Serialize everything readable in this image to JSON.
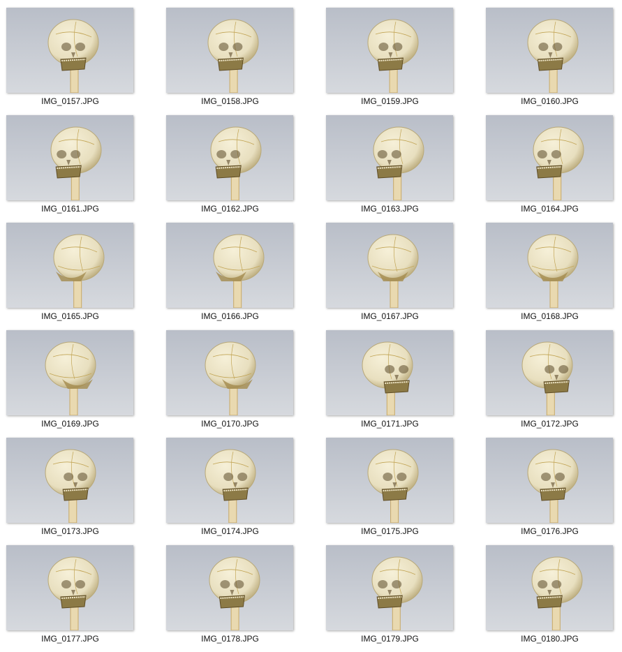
{
  "window": {
    "view": "large-icons",
    "files": [
      {
        "name": "IMG_0157.JPG",
        "icon": "skull-photo-thumbnail",
        "view": "front"
      },
      {
        "name": "IMG_0158.JPG",
        "icon": "skull-photo-thumbnail",
        "view": "front-right"
      },
      {
        "name": "IMG_0159.JPG",
        "icon": "skull-photo-thumbnail",
        "view": "front-right"
      },
      {
        "name": "IMG_0160.JPG",
        "icon": "skull-photo-thumbnail",
        "view": "front-right"
      },
      {
        "name": "IMG_0161.JPG",
        "icon": "skull-photo-thumbnail",
        "view": "left-oblique"
      },
      {
        "name": "IMG_0162.JPG",
        "icon": "skull-photo-thumbnail",
        "view": "left-oblique"
      },
      {
        "name": "IMG_0163.JPG",
        "icon": "skull-photo-thumbnail",
        "view": "left-side"
      },
      {
        "name": "IMG_0164.JPG",
        "icon": "skull-photo-thumbnail",
        "view": "left-side"
      },
      {
        "name": "IMG_0165.JPG",
        "icon": "skull-photo-thumbnail",
        "view": "left-back"
      },
      {
        "name": "IMG_0166.JPG",
        "icon": "skull-photo-thumbnail",
        "view": "left-back"
      },
      {
        "name": "IMG_0167.JPG",
        "icon": "skull-photo-thumbnail",
        "view": "back"
      },
      {
        "name": "IMG_0168.JPG",
        "icon": "skull-photo-thumbnail",
        "view": "back"
      },
      {
        "name": "IMG_0169.JPG",
        "icon": "skull-photo-thumbnail",
        "view": "right-back"
      },
      {
        "name": "IMG_0170.JPG",
        "icon": "skull-photo-thumbnail",
        "view": "right-back"
      },
      {
        "name": "IMG_0171.JPG",
        "icon": "skull-photo-thumbnail",
        "view": "right-side"
      },
      {
        "name": "IMG_0172.JPG",
        "icon": "skull-photo-thumbnail",
        "view": "right-side"
      },
      {
        "name": "IMG_0173.JPG",
        "icon": "skull-photo-thumbnail",
        "view": "right-oblique"
      },
      {
        "name": "IMG_0174.JPG",
        "icon": "skull-photo-thumbnail",
        "view": "right-oblique"
      },
      {
        "name": "IMG_0175.JPG",
        "icon": "skull-photo-thumbnail",
        "view": "front-left"
      },
      {
        "name": "IMG_0176.JPG",
        "icon": "skull-photo-thumbnail",
        "view": "front"
      },
      {
        "name": "IMG_0177.JPG",
        "icon": "skull-photo-thumbnail",
        "view": "front-up"
      },
      {
        "name": "IMG_0178.JPG",
        "icon": "skull-photo-thumbnail",
        "view": "front-left-up"
      },
      {
        "name": "IMG_0179.JPG",
        "icon": "skull-photo-thumbnail",
        "view": "left-up"
      },
      {
        "name": "IMG_0180.JPG",
        "icon": "skull-photo-thumbnail",
        "view": "left-up"
      }
    ]
  },
  "colors": {
    "background": "#ffffff",
    "photo_background_top": "#b9bec8",
    "photo_background_bottom": "#d6d9de",
    "bone": "#e8dfbf",
    "bone_shadow": "#b8a878",
    "dark_crevice": "#5b4a2a",
    "caption_text": "#111111"
  }
}
